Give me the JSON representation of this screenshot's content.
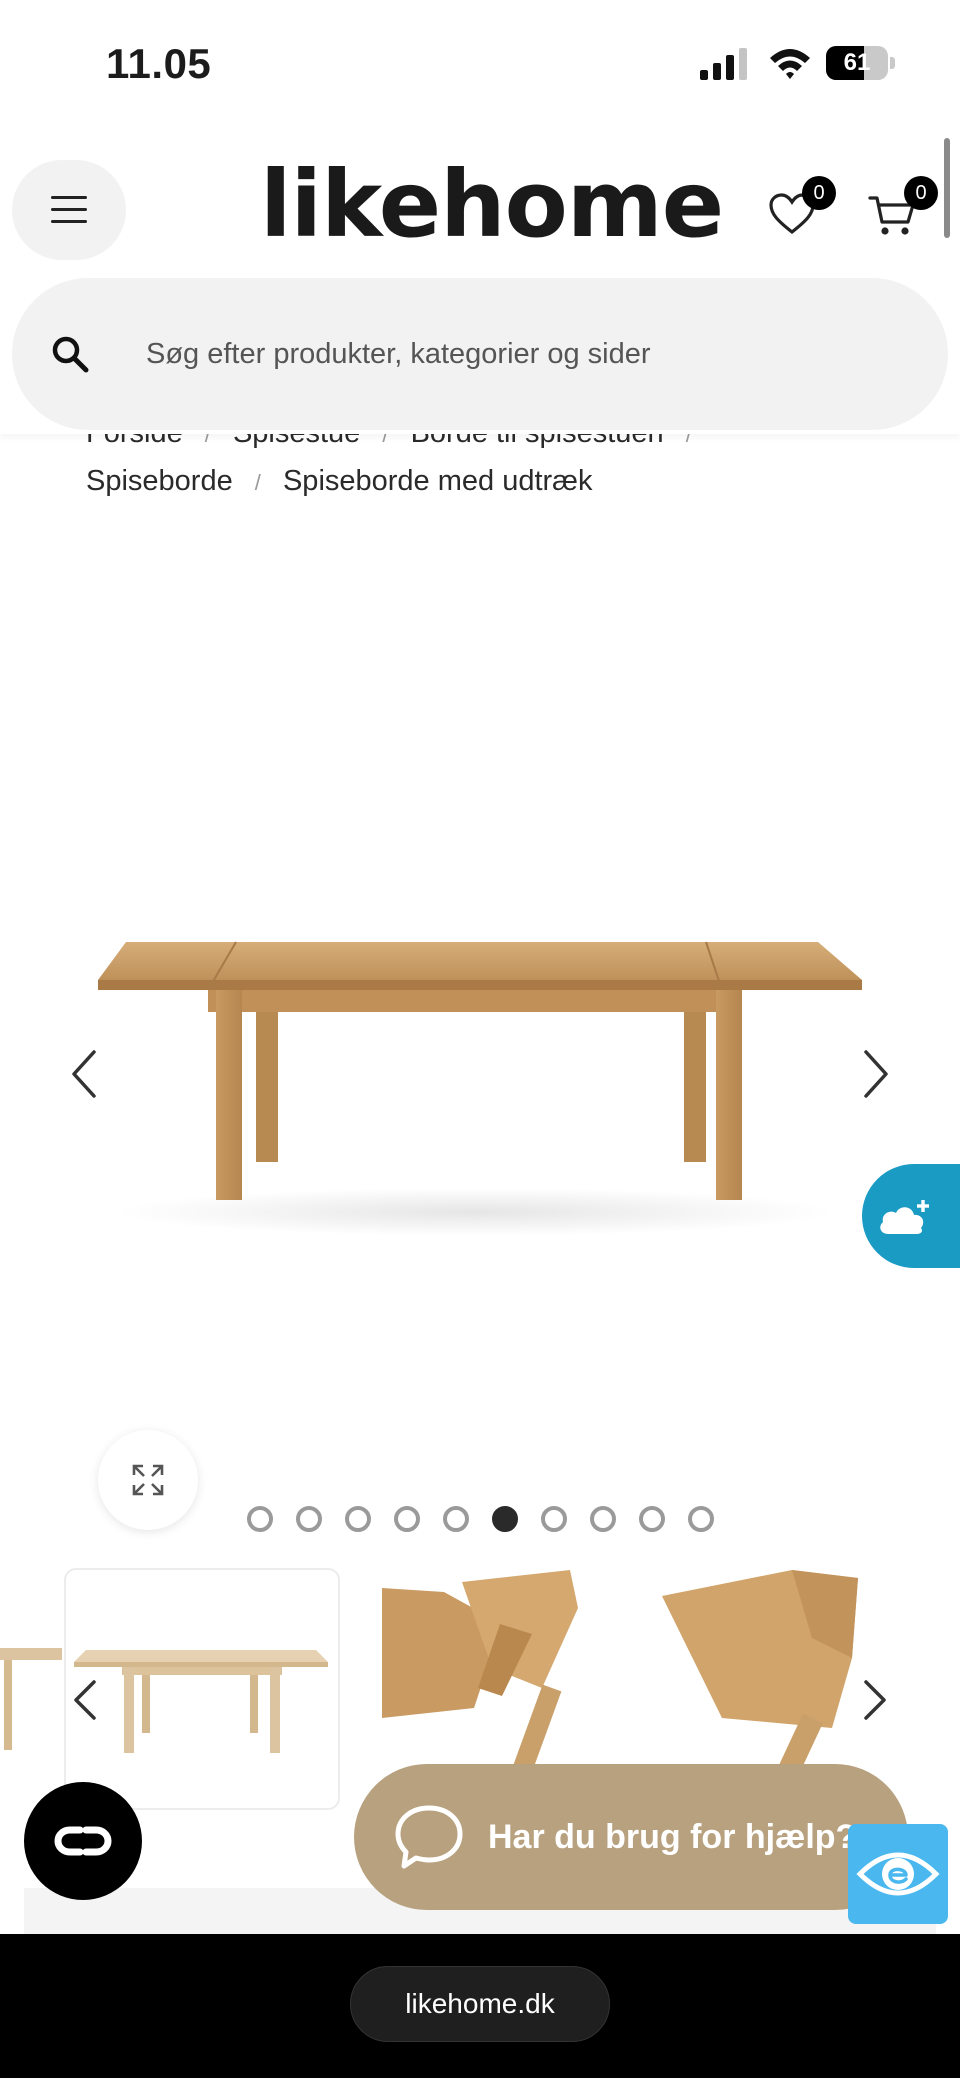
{
  "status_bar": {
    "time": "11.05",
    "battery_percent": 61,
    "battery_text": "61"
  },
  "header": {
    "logo_text": "likehome",
    "wishlist_count": "0",
    "cart_count": "0",
    "menu_icon": "hamburger-icon",
    "wishlist_icon": "heart-icon",
    "cart_icon": "cart-icon"
  },
  "search": {
    "placeholder": "Søg efter produkter, kategorier og sider",
    "icon": "search-icon"
  },
  "breadcrumb": {
    "items": [
      "Forside",
      "Spisestue",
      "Borde til spisestuen",
      "Spiseborde",
      "Spiseborde med udtræk"
    ],
    "separator": "/"
  },
  "gallery": {
    "image_count": 10,
    "active_index": 5,
    "prev_icon": "chevron-left-icon",
    "next_icon": "chevron-right-icon",
    "expand_icon": "expand-icon"
  },
  "help": {
    "label": "Har du brug for hjælp?",
    "chat_icon": "chat-bubble-icon"
  },
  "floating": {
    "weather_icon": "cloud-plus-icon",
    "chat_launcher_icon": "chat-link-icon",
    "accessibility_icon": "accessibility-eye-icon"
  },
  "browser": {
    "url": "likehome.dk"
  },
  "colors": {
    "help_button": "#b8a17f",
    "weather_button": "#1a9bc4",
    "accessibility_button": "#4ab8ef",
    "wood": "#c69a63"
  }
}
